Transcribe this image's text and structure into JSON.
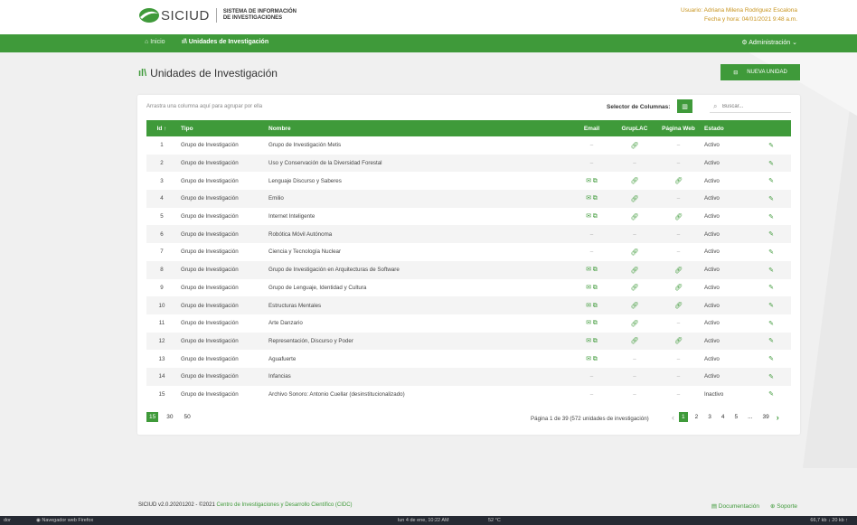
{
  "header": {
    "brand": "SICIUD",
    "subtitle_line1": "SISTEMA DE INFORMACIÓN",
    "subtitle_line2": "DE INVESTIGACIONES",
    "user": "Usuario: Adriana Milena Rodriguez Escalona",
    "datetime": "Fecha y hora: 04/01/2021 9:48 a.m."
  },
  "nav": {
    "home": "Inicio",
    "current": "Unidades de Investigación",
    "admin": "Administración"
  },
  "page": {
    "title": "Unidades de Investigación",
    "new_button": "NUEVA UNIDAD"
  },
  "grid": {
    "group_hint": "Arrastra una columna aquí para agrupar por ella",
    "column_selector": "Selector de Columnas:",
    "search_placeholder": "Buscar...",
    "columns": [
      "Id",
      "Tipo",
      "Nombre",
      "Email",
      "GrupLAC",
      "Página Web",
      "Estado"
    ],
    "rows": [
      {
        "id": "1",
        "tipo": "Grupo de Investigación",
        "nombre": "Grupo de Investigación Metis",
        "email": false,
        "gruplac": true,
        "web": false,
        "estado": "Activo"
      },
      {
        "id": "2",
        "tipo": "Grupo de Investigación",
        "nombre": "Uso y Conservación de la Diversidad Forestal",
        "email": false,
        "gruplac": false,
        "web": false,
        "estado": "Activo"
      },
      {
        "id": "3",
        "tipo": "Grupo de Investigación",
        "nombre": "Lenguaje Discurso y Saberes",
        "email": true,
        "gruplac": true,
        "web": true,
        "estado": "Activo"
      },
      {
        "id": "4",
        "tipo": "Grupo de Investigación",
        "nombre": "Emilio",
        "email": true,
        "gruplac": true,
        "web": false,
        "estado": "Activo"
      },
      {
        "id": "5",
        "tipo": "Grupo de Investigación",
        "nombre": "Internet Inteligente",
        "email": true,
        "gruplac": true,
        "web": true,
        "estado": "Activo"
      },
      {
        "id": "6",
        "tipo": "Grupo de Investigación",
        "nombre": "Robótica Móvil Autónoma",
        "email": false,
        "gruplac": false,
        "web": false,
        "estado": "Activo"
      },
      {
        "id": "7",
        "tipo": "Grupo de Investigación",
        "nombre": "Ciencia y Tecnología Nuclear",
        "email": false,
        "gruplac": true,
        "web": false,
        "estado": "Activo"
      },
      {
        "id": "8",
        "tipo": "Grupo de Investigación",
        "nombre": "Grupo de Investigación en Arquitecturas de Software",
        "email": true,
        "gruplac": true,
        "web": true,
        "estado": "Activo"
      },
      {
        "id": "9",
        "tipo": "Grupo de Investigación",
        "nombre": "Grupo de Lenguaje, Identidad y Cultura",
        "email": true,
        "gruplac": true,
        "web": true,
        "estado": "Activo"
      },
      {
        "id": "10",
        "tipo": "Grupo de Investigación",
        "nombre": "Estructuras Mentales",
        "email": true,
        "gruplac": true,
        "web": true,
        "estado": "Activo"
      },
      {
        "id": "11",
        "tipo": "Grupo de Investigación",
        "nombre": "Arte Danzario",
        "email": true,
        "gruplac": true,
        "web": false,
        "estado": "Activo"
      },
      {
        "id": "12",
        "tipo": "Grupo de Investigación",
        "nombre": "Representación, Discurso y Poder",
        "email": true,
        "gruplac": true,
        "web": true,
        "estado": "Activo"
      },
      {
        "id": "13",
        "tipo": "Grupo de Investigación",
        "nombre": "Aguafuerte",
        "email": true,
        "gruplac": false,
        "web": false,
        "estado": "Activo"
      },
      {
        "id": "14",
        "tipo": "Grupo de Investigación",
        "nombre": "Infancias",
        "email": false,
        "gruplac": false,
        "web": false,
        "estado": "Activo"
      },
      {
        "id": "15",
        "tipo": "Grupo de Investigación",
        "nombre": "Archivo Sonoro: Antonio Cuellar (desinstitucionalizado)",
        "email": false,
        "gruplac": false,
        "web": false,
        "estado": "Inactivo"
      }
    ],
    "page_sizes": [
      "15",
      "30",
      "50"
    ],
    "active_page_size": "15",
    "page_info": "Página 1 de 39 (572 unidades de investigación)",
    "pages": [
      "1",
      "2",
      "3",
      "4",
      "5",
      "...",
      "39"
    ],
    "active_page": "1"
  },
  "footer": {
    "version": "SICIUD v2.0.20201202 - ©2021",
    "center_link": "Centro de Investigaciones y Desarrollo Científico (CIDC)",
    "docs": "Documentación",
    "support": "Soporte"
  },
  "taskbar": {
    "left": "dor",
    "app": "Navegador web Firefox",
    "datetime": "lun 4 de ene, 10:22 AM",
    "weather": "52 °C",
    "right": "66,7 kb ↓  20 kb ↑"
  },
  "colors": {
    "brand_green": "#3f9a3a",
    "user_gold": "#c8941e"
  }
}
